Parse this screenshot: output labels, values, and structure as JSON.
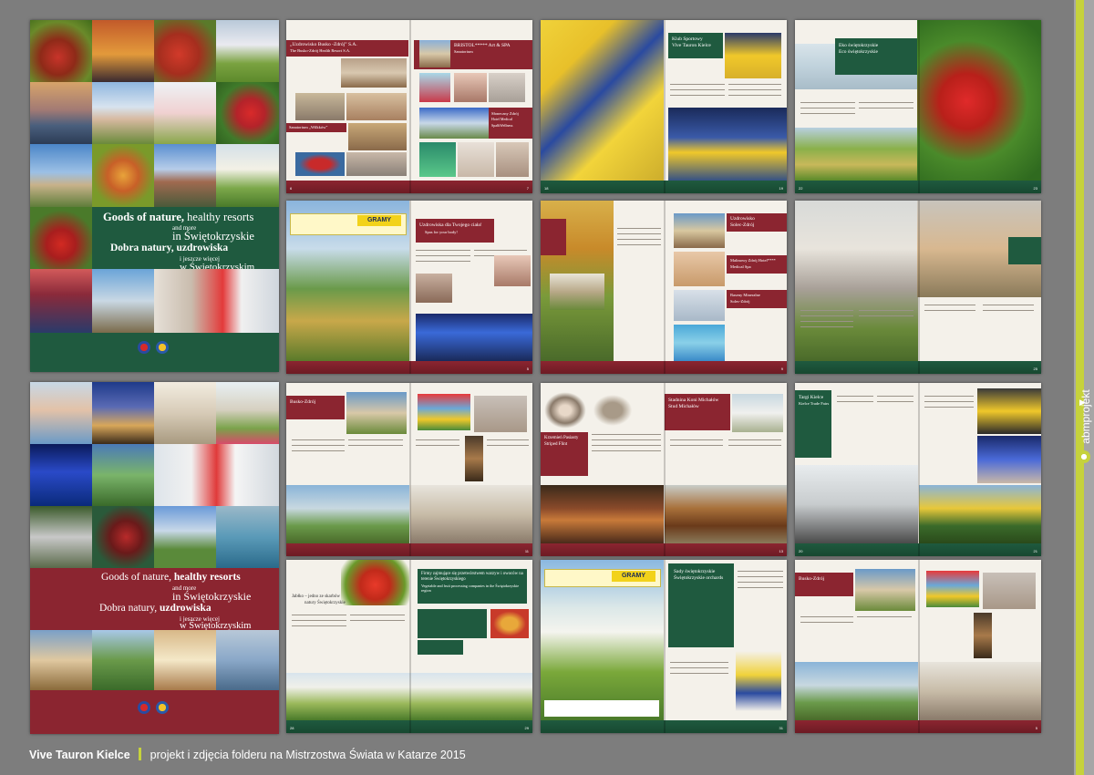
{
  "covers": {
    "green": {
      "title_en_1": "Goods of nature,",
      "title_en_1b": "healthy resorts",
      "title_en_2": "and more",
      "title_en_3": "in Świętokrzyskie",
      "title_pl_1": "Dobra natury, uzdrowiska",
      "title_pl_2": "i jeszcze więcej",
      "title_pl_3": "w Świętokrzyskim"
    },
    "red": {
      "title_en_1": "Goods of nature,",
      "title_en_1b": "healthy resorts",
      "title_en_2": "and more",
      "title_en_3": "in Świętokrzyskie",
      "title_pl_1a": "Dobra natury,",
      "title_pl_1b": "uzdrowiska",
      "title_pl_2": "i jeszcze więcej",
      "title_pl_3": "w Świętokrzyskim"
    }
  },
  "spreads": {
    "s1": {
      "left_title": "„Uzdrowisko Busko -Zdrój” S.A.",
      "left_sub": "The Busko-Zdrój Health Resort S.A.",
      "left_title2": "Sanatorium „Wilkków”",
      "right_title": "BRISTOL***** Art & SPA",
      "right_sub": "Sanatorium",
      "right_title2": "Słoneczny Zdrój",
      "right_sub2": "Hotel Medical Spa&Wellness",
      "page_left": "6",
      "page_right": "7"
    },
    "s2": {
      "box_title_1": "Klub Sportowy",
      "box_title_2": "Vive Tauron Kielce",
      "page_left": "18",
      "page_right": "19"
    },
    "s3": {
      "box_title_1": "Eko świętokrzyskie",
      "box_title_2": "Eco świętokrzyskie",
      "page_left": "22",
      "page_right": "23"
    },
    "s4": {
      "box_title": "Uzdrowiska dla Twojego ciała!",
      "box_sub": "Spas for your body!",
      "page_right": "5"
    },
    "s5": {
      "box_title_1": "Uzdrowisko",
      "box_title_2": "Solec-Zdrój",
      "box_title_3": "Malinowy Zdrój Hotel****",
      "box_title_4": "Medical Spa",
      "box_title_5": "Baseny Mineralne",
      "box_title_6": "Solec-Zdrój",
      "page_right": "9"
    },
    "s6": {
      "page_right": "25"
    },
    "s7": {
      "box_title": "Busko-Zdrój",
      "page_right": "11"
    },
    "s8": {
      "box_title_1": "Krzemień Pasiasty",
      "box_title_2": "Striped Flint",
      "box_title_3": "Stadnina Koni Michałów",
      "box_title_4": "Stud Michałów",
      "page_right": "13"
    },
    "s9": {
      "box_title_1": "Targi Kielce",
      "box_title_2": "Kielce Trade Fairs",
      "page_left": "20",
      "page_right": "21"
    },
    "s10": {
      "box_title_1": "Firmy zajmujące się przetwórstwem warzyw i owoców na terenie Świętokrzyskiego",
      "box_sub": "Vegetable and fruit processing companies in the Świętokrzyskie region",
      "left_head_1": "Jabłko – jedno ze skarbów",
      "left_head_2": "natury Świętokrzyskie",
      "page_left": "28",
      "page_right": "29"
    },
    "s11": {
      "box_title_1": "Sady świętokrzyskie",
      "box_title_2": "Świętokrzyskie orchards",
      "page_right": "31"
    },
    "s12": {
      "box_title": "Busko-Zdrój",
      "page_right": "5"
    }
  },
  "ad_brand": "GRAMY",
  "side_logo": "abmprojekt",
  "side_arrow": "▶",
  "caption": {
    "main": "Vive Tauron Kielce",
    "sub": "projekt i zdjęcia folderu na Mistrzostwa Świata w Katarze 2015"
  },
  "colors": {
    "maroon": "#8b2530",
    "green": "#1f5a3f",
    "lime": "#c6d23c",
    "background": "#7d7d7d"
  }
}
